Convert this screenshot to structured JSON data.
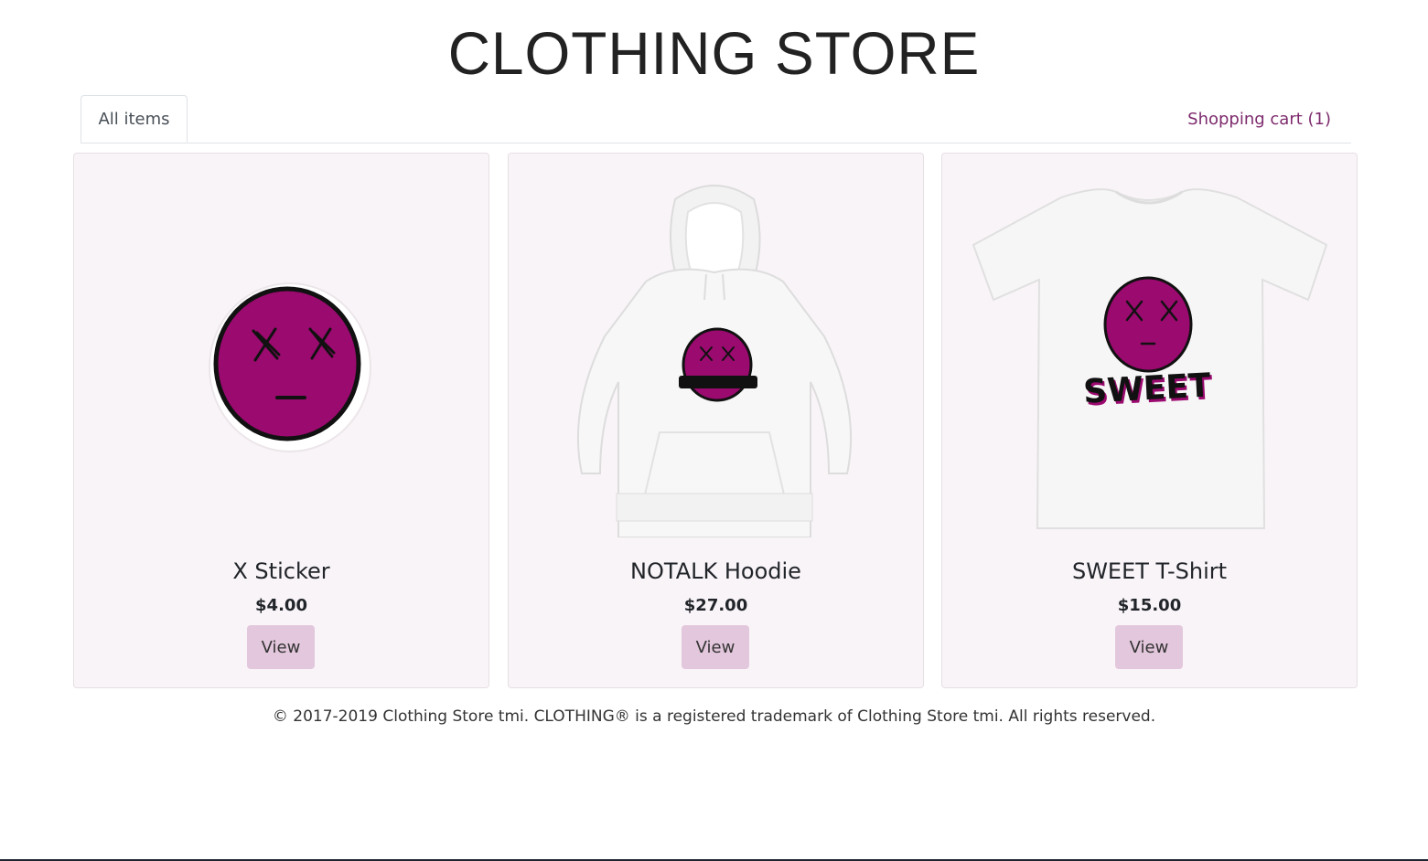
{
  "header": {
    "title": "CLOTHING STORE"
  },
  "nav": {
    "tab_all_items": "All items",
    "cart_link": "Shopping cart (1)"
  },
  "products": [
    {
      "name": "X Sticker",
      "price": "$4.00",
      "button": "View",
      "image": "x-face-sticker"
    },
    {
      "name": "NOTALK Hoodie",
      "price": "$27.00",
      "button": "View",
      "image": "white-hoodie-face"
    },
    {
      "name": "SWEET T-Shirt",
      "price": "$15.00",
      "button": "View",
      "image": "white-tshirt-sweet-face"
    }
  ],
  "tshirt_print_text": "SWEET",
  "footer": {
    "text": "© 2017-2019 Clothing Store tmi. CLOTHING® is a registered trademark of Clothing Store tmi. All rights reserved."
  },
  "colors": {
    "accent_link": "#7d2b6d",
    "face_magenta": "#9b0a6f",
    "button_bg": "#e3c7dc",
    "card_bg": "#f9f4f8"
  }
}
